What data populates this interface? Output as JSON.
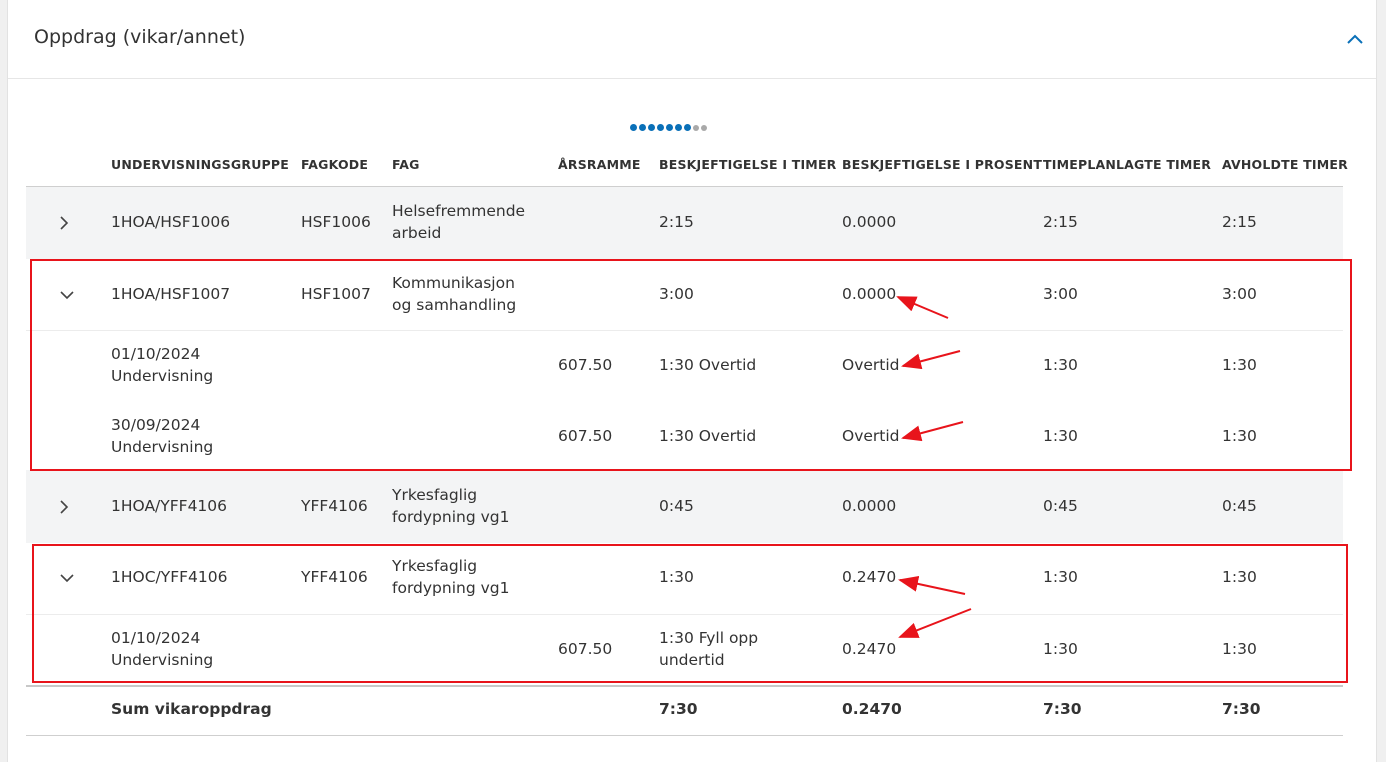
{
  "card": {
    "title": "Oppdrag (vikar/annet)"
  },
  "columns": {
    "group": "UNDERVISNINGSGRUPPE",
    "code": "FAGKODE",
    "subject": "FAG",
    "frame": "ÅRSRAMME",
    "hours": "BESKJEFTIGELSE I TIMER",
    "percent": "BESKJEFTIGELSE I PROSENT",
    "planned": "TIMEPLANLAGTE TIMER",
    "held": "AVHOLDTE TIMER"
  },
  "pagination": {
    "total_dots": 9,
    "active_dots": 7
  },
  "rows": [
    {
      "group": "1HOA/HSF1006",
      "code": "HSF1006",
      "subject_l1": "Helsefremmende",
      "subject_l2": "arbeid",
      "hours": "2:15",
      "percent": "0.0000",
      "planned": "2:15",
      "held": "2:15"
    },
    {
      "group": "1HOA/HSF1007",
      "code": "HSF1007",
      "subject_l1": "Kommunikasjon",
      "subject_l2": "og samhandling",
      "hours": "3:00",
      "percent": "0.0000",
      "planned": "3:00",
      "held": "3:00"
    },
    {
      "group_l1": "01/10/2024",
      "group_l2": "Undervisning",
      "frame": "607.50",
      "hours": "1:30 Overtid",
      "percent": "Overtid",
      "planned": "1:30",
      "held": "1:30"
    },
    {
      "group_l1": "30/09/2024",
      "group_l2": "Undervisning",
      "frame": "607.50",
      "hours": "1:30 Overtid",
      "percent": "Overtid",
      "planned": "1:30",
      "held": "1:30"
    },
    {
      "group": "1HOA/YFF4106",
      "code": "YFF4106",
      "subject_l1": "Yrkesfaglig",
      "subject_l2": "fordypning vg1",
      "hours": "0:45",
      "percent": "0.0000",
      "planned": "0:45",
      "held": "0:45"
    },
    {
      "group": "1HOC/YFF4106",
      "code": "YFF4106",
      "subject_l1": "Yrkesfaglig",
      "subject_l2": "fordypning vg1",
      "hours": "1:30",
      "percent": "0.2470",
      "planned": "1:30",
      "held": "1:30"
    },
    {
      "group_l1": "01/10/2024",
      "group_l2": "Undervisning",
      "frame": "607.50",
      "hours_l1": "1:30 Fyll opp",
      "hours_l2": "undertid",
      "percent": "0.2470",
      "planned": "1:30",
      "held": "1:30"
    }
  ],
  "sum": {
    "label": "Sum vikaroppdrag",
    "hours": "7:30",
    "percent": "0.2470",
    "planned": "7:30",
    "held": "7:30"
  },
  "colors": {
    "accent": "#0a70b8",
    "annotation": "#e8141b",
    "row_gray": "#f3f4f5"
  },
  "icons": {
    "collapse": "chevron-up-icon",
    "expand": "chevron-right-icon",
    "expanded": "chevron-down-icon"
  }
}
